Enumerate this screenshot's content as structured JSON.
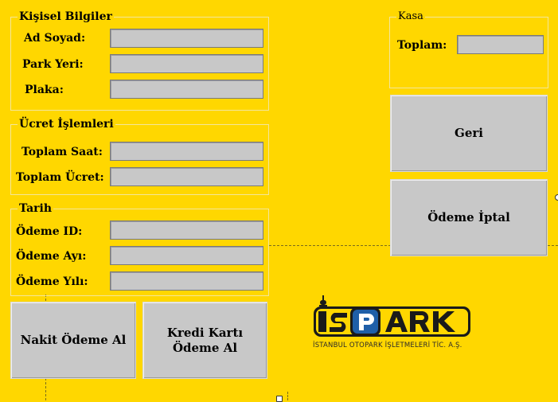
{
  "personal": {
    "title": "Kişisel Bilgiler",
    "name_label": "Ad Soyad:",
    "park_label": "Park Yeri:",
    "plate_label": "Plaka:",
    "name_value": "",
    "park_value": "",
    "plate_value": ""
  },
  "fee": {
    "title": "Ücret İşlemleri",
    "hours_label": "Toplam Saat:",
    "total_label": "Toplam Ücret:",
    "hours_value": "",
    "total_value": ""
  },
  "date": {
    "title": "Tarih",
    "id_label": "Ödeme ID:",
    "month_label": "Ödeme Ayı:",
    "year_label": "Ödeme Yılı:",
    "id_value": "",
    "month_value": "",
    "year_value": ""
  },
  "cash_register": {
    "title": "Kasa",
    "total_label": "Toplam:",
    "total_value": ""
  },
  "buttons": {
    "cash_payment": "Nakit Ödeme Al",
    "card_payment_line1": "Kredi Kartı",
    "card_payment_line2": "Ödeme Al",
    "back": "Geri",
    "cancel_payment": "Ödeme İptal"
  },
  "logo": {
    "brand": "İSPARK",
    "company": "İSTANBUL OTOPARK İŞLETMELERİ TİC. A.Ş.",
    "colors": {
      "black": "#1a1a1a",
      "blue": "#1f5fa8",
      "yellow": "#FFD700"
    }
  },
  "theme": {
    "background": "#FFD700",
    "field": "#C8C8C8"
  }
}
